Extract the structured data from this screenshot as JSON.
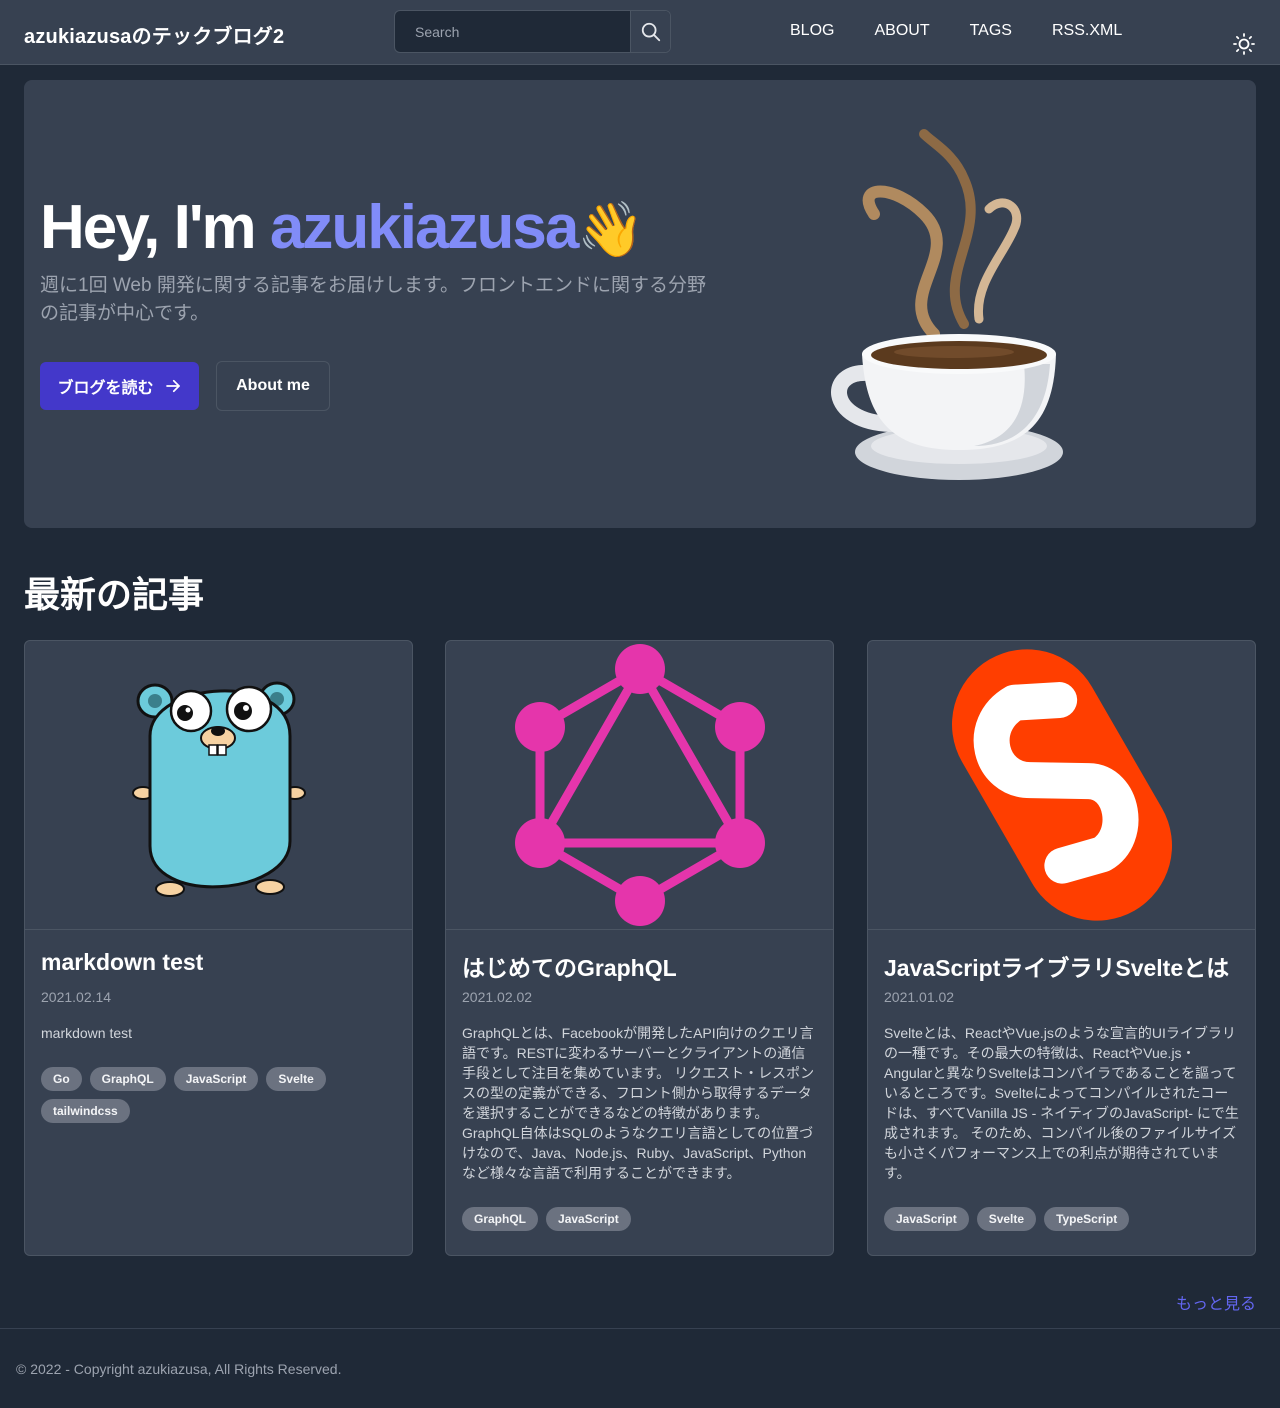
{
  "header": {
    "site_title": "azukiazusaのテックブログ2",
    "search_placeholder": "Search",
    "nav": [
      "BLOG",
      "ABOUT",
      "TAGS",
      "RSS.XML"
    ],
    "theme_icon": "sun-icon"
  },
  "hero": {
    "title_prefix": "Hey, I'm ",
    "title_name": "azukiazusa",
    "wave_emoji": "👋",
    "description": "週に1回 Web 開発に関する記事をお届けします。フロントエンドに関する分野の記事が中心です。",
    "primary_button": "ブログを読む",
    "secondary_button": "About me",
    "illustration": "coffee-cup"
  },
  "latest": {
    "title": "最新の記事",
    "more_link": "もっと見る",
    "cards": [
      {
        "title": "markdown test",
        "date": "2021.02.14",
        "description": "markdown test",
        "image": "go-gopher",
        "tags": [
          "Go",
          "GraphQL",
          "JavaScript",
          "Svelte",
          "tailwindcss"
        ]
      },
      {
        "title": "はじめてのGraphQL",
        "date": "2021.02.02",
        "description": "GraphQLとは、Facebookが開発したAPI向けのクエリ言語です。RESTに変わるサーバーとクライアントの通信手段として注目を集めています。 リクエスト・レスポンスの型の定義ができる、フロント側から取得するデータを選択することができるなどの特徴があります。 GraphQL自体はSQLのようなクエリ言語としての位置づけなので、Java、Node.js、Ruby、JavaScript、Pythonなど様々な言語で利用することができます。",
        "image": "graphql-logo",
        "tags": [
          "GraphQL",
          "JavaScript"
        ]
      },
      {
        "title": "JavaScriptライブラリSvelteとは",
        "date": "2021.01.02",
        "description": "Svelteとは、ReactやVue.jsのような宣言的UIライブラリの一種です。その最大の特徴は、ReactやVue.js・Angularと異なりSvelteはコンパイラであることを謳っているところです。Svelteによってコンパイルされたコードは、すべてVanilla JS - ネイティブのJavaScript- にで生成されます。 そのため、コンパイル後のファイルサイズも小さくパフォーマンス上での利点が期待されています。",
        "image": "svelte-logo",
        "tags": [
          "JavaScript",
          "Svelte",
          "TypeScript"
        ]
      }
    ]
  },
  "footer": {
    "copyright": "© 2022 - Copyright azukiazusa, All Rights Reserved."
  },
  "colors": {
    "background": "#1f2937",
    "surface": "#374151",
    "accent": "#818cf8",
    "primary_button": "#4338ca",
    "link": "#6366f1",
    "tag": "#6b7280",
    "graphql": "#e535ab",
    "svelte": "#ff3e00",
    "gopher": "#6ccbdb"
  }
}
